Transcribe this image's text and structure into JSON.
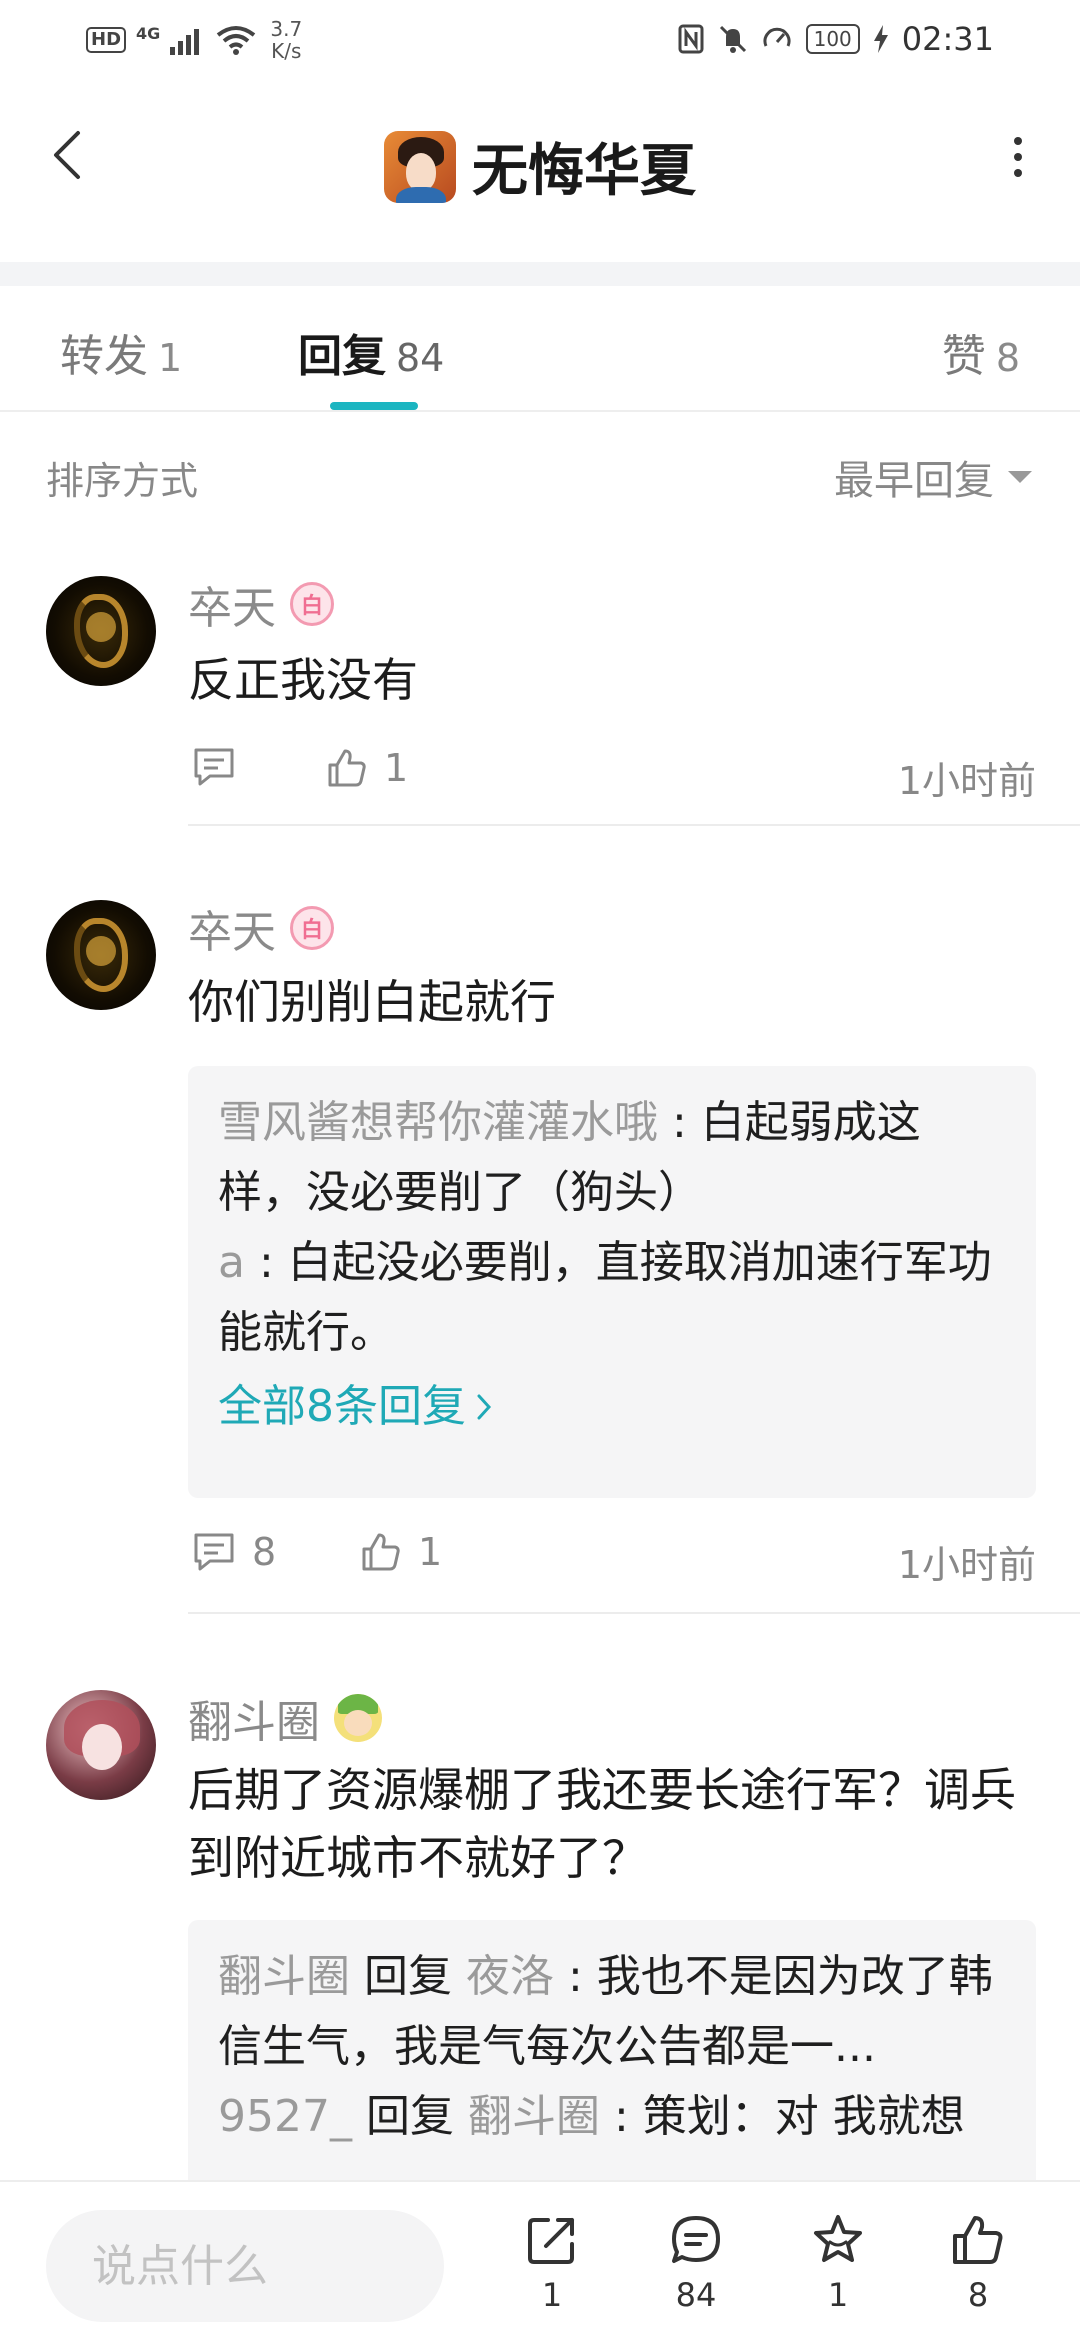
{
  "status_bar": {
    "network": "4G",
    "speed": "3.7\nK/s",
    "battery": "100",
    "time": "02:31"
  },
  "header": {
    "title": "无悔华夏"
  },
  "tabs": [
    {
      "label": "转发",
      "count": "1"
    },
    {
      "label": "回复",
      "count": "84"
    },
    {
      "label": "赞",
      "count": "8"
    }
  ],
  "sort": {
    "label": "排序方式",
    "selected": "最早回复"
  },
  "comments": [
    {
      "author": "卒天",
      "text": "反正我没有",
      "reply_count": "",
      "likes": "1",
      "time": "1小时前"
    },
    {
      "author": "卒天",
      "text": "你们别削白起就行",
      "replies": [
        {
          "name": "雪风酱想帮你灌灌水哦",
          "sep": " : ",
          "text": "白起弱成这样，没必要削了（狗头）"
        },
        {
          "name": "a",
          "sep": " : ",
          "text": "白起没必要削，直接取消加速行军功能就行。"
        }
      ],
      "more": "全部8条回复",
      "reply_count": "8",
      "likes": "1",
      "time": "1小时前"
    },
    {
      "author": "翻斗圈",
      "text": "后期了资源爆棚了我还要长途行军？调兵到附近城市不就好了？",
      "replies": [
        {
          "name": "翻斗圈",
          "verb": " 回复 ",
          "target": "夜洛",
          "sep": " : ",
          "text": "我也不是因为改了韩信生气，我是气每次公告都是一..."
        },
        {
          "name": "9527_",
          "verb": " 回复 ",
          "target": "翻斗圈",
          "sep": " : ",
          "text": "策划：对 我就想"
        }
      ]
    }
  ],
  "bottom_bar": {
    "placeholder": "说点什么",
    "share_count": "1",
    "comment_count": "84",
    "favorite_count": "1",
    "like_count": "8"
  }
}
